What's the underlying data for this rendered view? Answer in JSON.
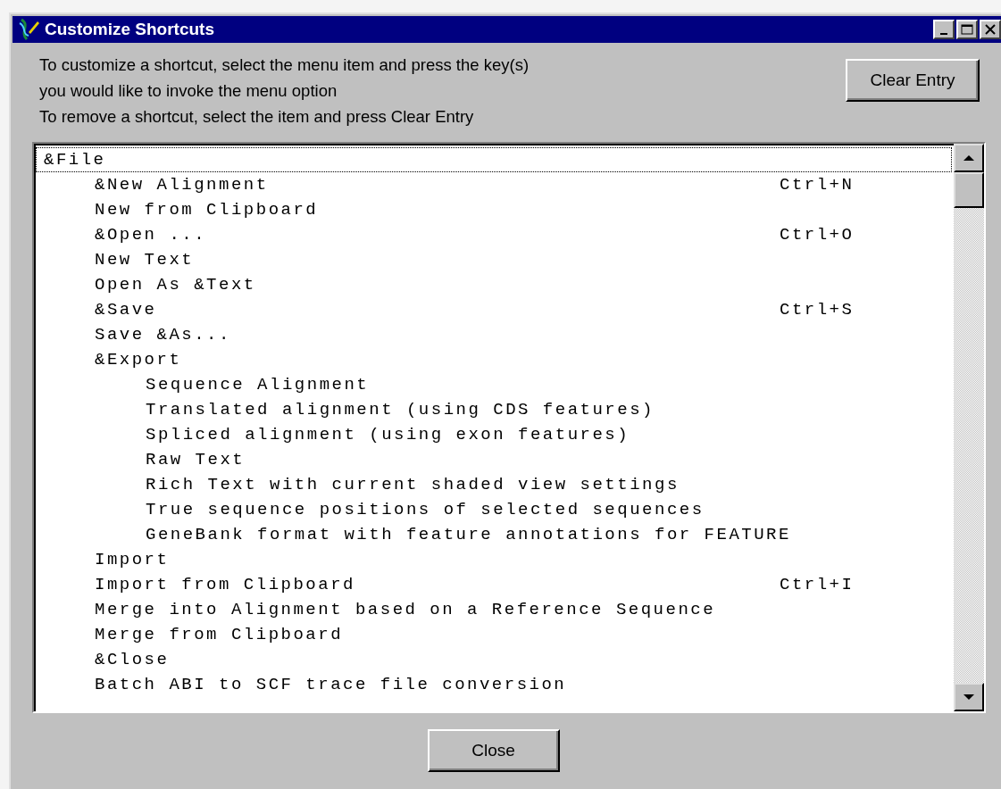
{
  "window": {
    "title": "Customize Shortcuts"
  },
  "instructions": [
    "To customize a shortcut, select the menu item and press the key(s)",
    "you would like to invoke the menu option",
    "To remove a shortcut, select the item and press Clear Entry"
  ],
  "clear_button": "Clear Entry",
  "menu_tree": [
    {
      "label": "&File",
      "selected": true,
      "children": [
        {
          "label": "&New Alignment",
          "shortcut": "Ctrl+N",
          "selected": false
        },
        {
          "label": "New from Clipboard",
          "selected": false
        },
        {
          "label": "&Open ...",
          "shortcut": "Ctrl+O",
          "selected": false
        },
        {
          "label": "New Text",
          "selected": false
        },
        {
          "label": "Open As &Text",
          "selected": false
        },
        {
          "label": "&Save",
          "shortcut": "Ctrl+S",
          "selected": false
        },
        {
          "label": "Save &As...",
          "selected": false
        },
        {
          "label": "&Export",
          "selected": false,
          "children": [
            {
              "label": "Sequence Alignment",
              "selected": false
            },
            {
              "label": "Translated alignment (using CDS features)",
              "selected": false
            },
            {
              "label": "Spliced alignment (using exon features)",
              "selected": false
            },
            {
              "label": "Raw Text",
              "selected": false
            },
            {
              "label": "Rich Text with current shaded view settings",
              "selected": false
            },
            {
              "label": "True sequence positions of selected sequences",
              "selected": false
            },
            {
              "label": "GeneBank format with feature annotations for FEATURE",
              "selected": false
            }
          ]
        },
        {
          "label": "Import",
          "selected": false
        },
        {
          "label": "Import from Clipboard",
          "shortcut": "Ctrl+I",
          "selected": false
        },
        {
          "label": "Merge into Alignment based on a Reference Sequence",
          "selected": false
        },
        {
          "label": "Merge from Clipboard",
          "selected": false
        },
        {
          "label": "&Close",
          "selected": false
        },
        {
          "label": "Batch ABI to SCF trace file conversion",
          "selected": false
        }
      ]
    }
  ],
  "close_button": "Close"
}
